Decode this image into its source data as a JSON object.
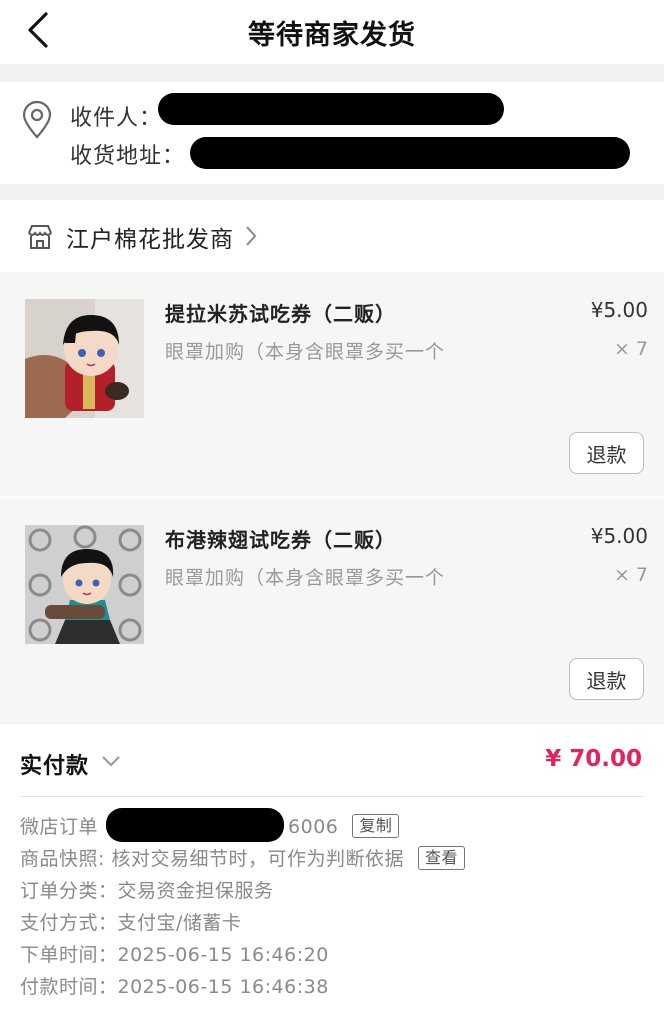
{
  "header": {
    "title": "等待商家发货"
  },
  "address": {
    "recipient_label": "收件人：",
    "address_label": "收货地址："
  },
  "shop": {
    "name": "江户棉花批发商"
  },
  "items": [
    {
      "name": "提拉米苏试吃券（二贩）",
      "spec": "眼罩加购（本身含眼罩多买一个",
      "price": "¥5.00",
      "qty": "× 7",
      "refund_label": "退款",
      "image": "plush-doll-red-outfit"
    },
    {
      "name": "布港辣翅试吃券（二贩）",
      "spec": "眼罩加购（本身含眼罩多买一个",
      "price": "¥5.00",
      "qty": "× 7",
      "refund_label": "退款",
      "image": "plush-doll-teal-outfit"
    }
  ],
  "payment": {
    "label": "实付款",
    "amount": "¥ 70.00",
    "amount_color": "#e0245e"
  },
  "order_info": {
    "order_no_label": "微店订单",
    "order_no_tail": "6006",
    "copy_label": "复制",
    "snapshot_text": "商品快照: 核对交易细节时，可作为判断依据",
    "view_label": "查看",
    "category": "订单分类：交易资金担保服务",
    "pay_method": "支付方式：支付宝/储蓄卡",
    "order_time": "下单时间：2025-06-15 16:46:20",
    "pay_time": "付款时间：2025-06-15 16:46:38"
  }
}
